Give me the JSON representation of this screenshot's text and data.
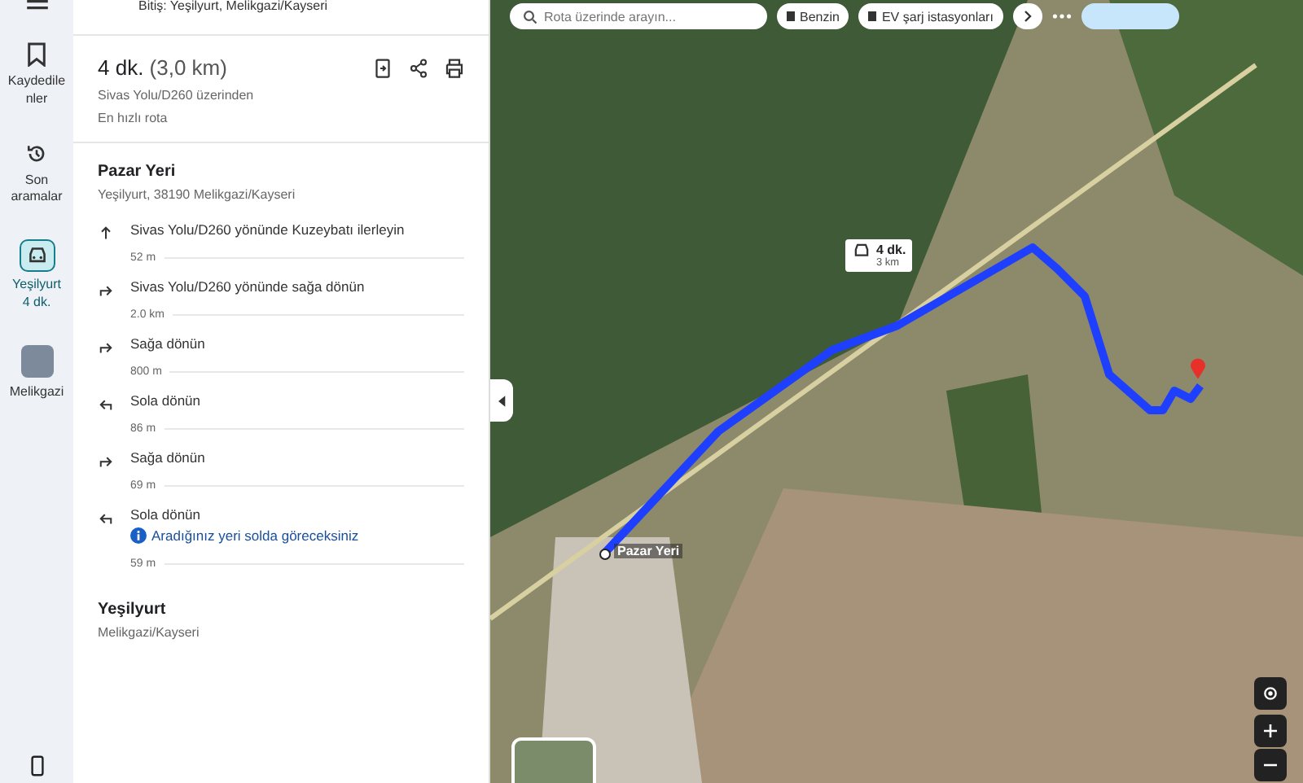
{
  "rail": {
    "items": [
      {
        "kind": "saved",
        "label": "Kaydedilenler",
        "selected": false
      },
      {
        "kind": "history",
        "label": "Son aramalar",
        "selected": false
      },
      {
        "kind": "car",
        "label": "Yeşilyurt",
        "sub": "4 dk.",
        "selected": true
      },
      {
        "kind": "thumb",
        "label": "Melikgazi",
        "selected": false
      }
    ]
  },
  "destination_line": {
    "prefix": "Bitiş:",
    "value": "Yeşilyurt, Melikgazi/Kayseri"
  },
  "route": {
    "time": "4 dk.",
    "distance": "(3,0 km)",
    "via": "Sivas Yolu/D260 üzerinden",
    "note": "En hızlı rota"
  },
  "start": {
    "name": "Pazar Yeri",
    "address": "Yeşilyurt, 38190 Melikgazi/Kayseri"
  },
  "steps": [
    {
      "kind": "straight",
      "text": "Sivas Yolu/D260 yönünde Kuzeybatı ilerleyin",
      "distance": "52 m"
    },
    {
      "kind": "right",
      "text": "Sivas Yolu/D260 yönünde sağa dönün",
      "distance": "2.0 km"
    },
    {
      "kind": "right",
      "text": "Sağa dönün",
      "distance": "800 m"
    },
    {
      "kind": "left",
      "text": "Sola dönün",
      "distance": "86 m"
    },
    {
      "kind": "right",
      "text": "Sağa dönün",
      "distance": "69 m"
    },
    {
      "kind": "left",
      "text": "Sola dönün",
      "info": "Aradığınız yeri solda göreceksiniz",
      "distance": "59 m"
    }
  ],
  "end": {
    "name": "Yeşilyurt",
    "address": "Melikgazi/Kayseri"
  },
  "map": {
    "search_placeholder": "Rota üzerinde arayın...",
    "chips": [
      "Benzin",
      "EV şarj istasyonları"
    ],
    "callout": {
      "time": "4 dk.",
      "distance": "3 km"
    },
    "start_label": "Pazar Yeri"
  }
}
